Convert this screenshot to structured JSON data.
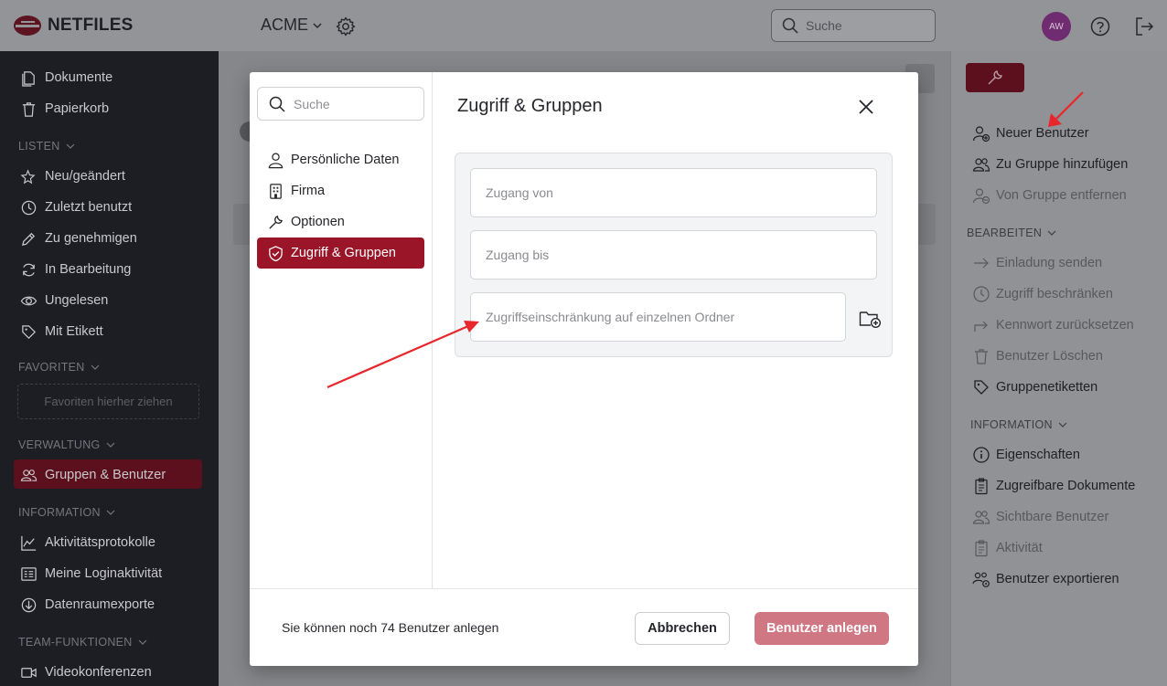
{
  "app": {
    "brand": "NETFILES",
    "org": "ACME",
    "search_placeholder": "Suche",
    "avatar_initials": "AW"
  },
  "sidebar": {
    "top_items": [
      {
        "label": "Dokumente",
        "icon": "document-icon"
      },
      {
        "label": "Papierkorb",
        "icon": "trash-icon"
      }
    ],
    "sections": {
      "listen": "LISTEN",
      "favoriten": "FAVORITEN",
      "verwaltung": "VERWALTUNG",
      "information": "INFORMATION",
      "team": "TEAM-FUNKTIONEN"
    },
    "listen_items": [
      "Neu/geändert",
      "Zuletzt benutzt",
      "Zu genehmigen",
      "In Bearbeitung",
      "Ungelesen",
      "Mit Etikett"
    ],
    "favorites_drop": "Favoriten hierher ziehen",
    "verwaltung_items": [
      "Gruppen & Benutzer"
    ],
    "information_items": [
      "Aktivitätsprotokolle",
      "Meine Loginaktivität",
      "Datenraumexporte"
    ],
    "team_items": [
      "Videokonferenzen"
    ]
  },
  "right_panel": {
    "actions": [
      "Neuer Benutzer",
      "Zu Gruppe hinzufügen",
      "Von Gruppe entfernen"
    ],
    "bearbeiten_label": "BEARBEITEN",
    "bearbeiten": [
      "Einladung senden",
      "Zugriff beschränken",
      "Kennwort zurücksetzen",
      "Benutzer Löschen",
      "Gruppenetiketten"
    ],
    "information_label": "INFORMATION",
    "information": [
      "Eigenschaften",
      "Zugreifbare Dokumente",
      "Sichtbare Benutzer",
      "Aktivität",
      "Benutzer exportieren"
    ]
  },
  "modal": {
    "search_placeholder": "Suche",
    "nav": [
      "Persönliche Daten",
      "Firma",
      "Optionen",
      "Zugriff & Gruppen"
    ],
    "title": "Zugriff & Gruppen",
    "fields": {
      "access_from": "Zugang von",
      "access_to": "Zugang bis",
      "folder_restriction": "Zugriffseinschränkung auf einzelnen Ordner"
    },
    "footer_info": "Sie können noch 74 Benutzer anlegen",
    "cancel": "Abbrechen",
    "create": "Benutzer anlegen"
  },
  "colors": {
    "accent": "#9a1528",
    "accent_dark": "#5c0f1c",
    "create_button": "#cf7782",
    "annotation_arrow": "#e8262b"
  }
}
